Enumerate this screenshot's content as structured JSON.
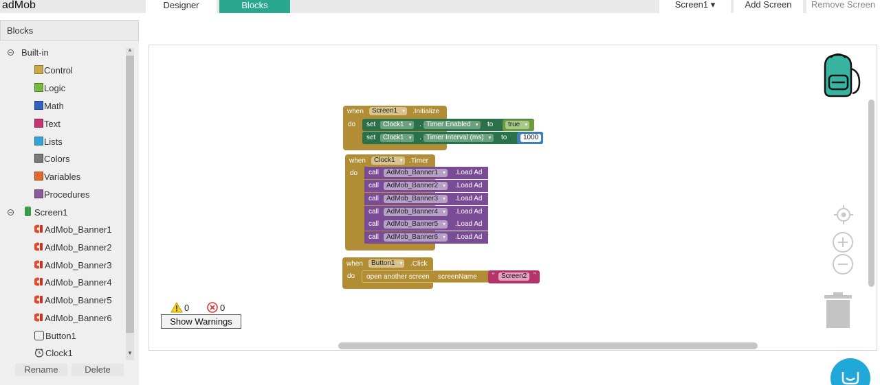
{
  "app": {
    "title": "adMob"
  },
  "tabs": {
    "designer": "Designer",
    "blocks": "Blocks"
  },
  "topbar": {
    "screen_select": "Screen1 ▾",
    "add_screen": "Add Screen",
    "remove_screen": "Remove Screen"
  },
  "panel": {
    "header": "Blocks",
    "builtin": "Built-in",
    "categories": [
      {
        "label": "Control",
        "color": "#c9a84a"
      },
      {
        "label": "Logic",
        "color": "#7ab93f"
      },
      {
        "label": "Math",
        "color": "#2f62c1"
      },
      {
        "label": "Text",
        "color": "#c43673"
      },
      {
        "label": "Lists",
        "color": "#34a3d6"
      },
      {
        "label": "Colors",
        "color": "#7a7a7a"
      },
      {
        "label": "Variables",
        "color": "#e26b2b"
      },
      {
        "label": "Procedures",
        "color": "#8b5a9b"
      }
    ],
    "screen": "Screen1",
    "components": [
      "AdMob_Banner1",
      "AdMob_Banner2",
      "AdMob_Banner3",
      "AdMob_Banner4",
      "AdMob_Banner5",
      "AdMob_Banner6",
      "Button1",
      "Clock1"
    ],
    "rename": "Rename",
    "delete": "Delete"
  },
  "warnings": {
    "warning_count": "0",
    "error_count": "0",
    "show_button": "Show Warnings"
  },
  "blocks": {
    "init": {
      "when": "when",
      "component": "Screen1",
      "event": ".Initialize",
      "do": "do",
      "set1": {
        "set": "set",
        "component": "Clock1",
        "dot": ".",
        "prop": "Timer Enabled",
        "to": "to",
        "value": "true"
      },
      "set2": {
        "set": "set",
        "component": "Clock1",
        "dot": ".",
        "prop": "Timer Interval (ms)",
        "to": "to",
        "value": "1000"
      }
    },
    "timer": {
      "when": "when",
      "component": "Clock1",
      "event": ".Timer",
      "do": "do",
      "calls": [
        {
          "call": "call",
          "component": "AdMob_Banner1",
          "method": ".Load Ad"
        },
        {
          "call": "call",
          "component": "AdMob_Banner2",
          "method": ".Load Ad"
        },
        {
          "call": "call",
          "component": "AdMob_Banner3",
          "method": ".Load Ad"
        },
        {
          "call": "call",
          "component": "AdMob_Banner4",
          "method": ".Load Ad"
        },
        {
          "call": "call",
          "component": "AdMob_Banner5",
          "method": ".Load Ad"
        },
        {
          "call": "call",
          "component": "AdMob_Banner6",
          "method": ".Load Ad"
        }
      ]
    },
    "click": {
      "when": "when",
      "component": "Button1",
      "event": ".Click",
      "do": "do",
      "open": "open another screen",
      "param": "screenName",
      "quote_open": "“",
      "value": "Screen2",
      "quote_close": "”"
    }
  },
  "icons": {
    "backpack": "backpack-icon",
    "target": "target-icon",
    "zoom_in": "zoom-in-icon",
    "zoom_out": "zoom-out-icon",
    "trash": "trash-icon",
    "chat": "chat-icon",
    "warning": "warning-icon",
    "error": "error-icon"
  },
  "colors": {
    "accent": "#2aa88f",
    "event_block": "#b18e35",
    "setter_block": "#2a7149",
    "call_block": "#7b4c96"
  }
}
